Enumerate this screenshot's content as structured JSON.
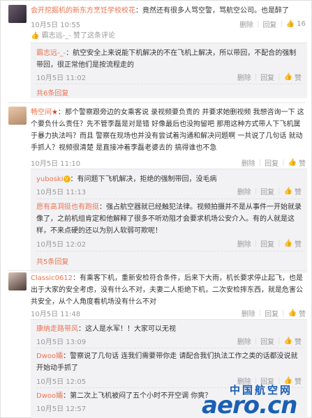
{
  "comments": [
    {
      "author": "会开挖掘机的新东方烹饪学校校花",
      "text": "：竟然还有很多人骂空警，骂航空公司。也是醉了",
      "time": "10月5日 10:55",
      "actions": {
        "delete": "删除",
        "reply": "回复",
        "likes": "16"
      },
      "liked_by": "霸志远-_- 赞了这条评论",
      "replies": [
        {
          "author": "霸志远-_-",
          "text": "：航空安全上来说能下机解决的不在飞机上解决，所以带回，不配合的强制带回，很正常他们是按流程走的",
          "time": "10月5日 11:02",
          "actions": {
            "delete": "删除",
            "reply": "回复",
            "likes": "赞"
          }
        }
      ],
      "more_replies": "共6条回复"
    },
    {
      "author": "畅空间",
      "text": "：那个警察跟旁边的女乘客说 录视频要负责的 并要求她删视频 我想咨询一下 这个要负什么责任？先不管李磊是对是错 好像最后也没拘留吧 那用这种方式带人下飞机属于暴力执法吗？而且 警察在现场也并没有尝试着沟通和解决问题啊 一共说了几句话 就动手抓人？视频很清楚 是直接冲着李磊老婆去的 搞得谁也不急",
      "time": "10月5日 11:10",
      "actions": {
        "delete": "删除",
        "reply": "回复",
        "likes": "赞"
      },
      "replies": [
        {
          "author": "yuboski",
          "text": "：有问题下飞机解决，拒绝的强制带回，没毛病",
          "time": "10月5日 11:13",
          "actions": {
            "delete": "删除",
            "reply": "回复",
            "likes": "赞"
          }
        },
        {
          "author": "愿有高洞挺也有跑挺",
          "text": "：强占航空器就已经触犯法律。视频拍摄并不是从事件一开始就录像了，之前机组肯定和他解释了很多不听劝阻才会要求机场公安介入。有的人就是这样，不来点硬的还以为别人软弱可欺呢！",
          "time": "10月5日 12:02",
          "actions": {
            "delete": "删除",
            "reply": "回复",
            "likes": "赞"
          }
        }
      ],
      "more_replies": "共5条回复"
    },
    {
      "author": "Classic0612",
      "text": "：有乘客下机，重新安检符合条件，后来下大雨，机长要求停止起飞，也是出于大家的安全考虑，没有什么不对，夫妻二人拒绝下机，二次安检摔东西，就是危害公共安全，从个人角度看机场没有什么不对",
      "time": "10月5日 11:48",
      "actions": {
        "delete": "删除",
        "reply": "回复",
        "likes": "赞"
      },
      "replies": [
        {
          "author": "康纳走路带风",
          "text": "：这人是水军！！大家可以无视",
          "time": "10月5日 13:09",
          "actions": {
            "delete": "删除",
            "reply": "回复",
            "likes": "赞"
          }
        },
        {
          "author": "Dwoo孀",
          "text": "：警察说了几句话 连我们需要带你走 请配合我们执法工作之类的话都没说就开始动手抓了",
          "time": "10月5日 12:05",
          "actions": {
            "delete": "删除",
            "reply": "回复",
            "likes": "赞"
          }
        },
        {
          "author": "Dwoo孀",
          "text": "：第二次上飞机被闷了五个小时不开空调 你爽？",
          "time": "10月5日 12:57",
          "actions": {
            "delete": "删除",
            "reply": "回复",
            "likes": "赞"
          }
        }
      ]
    }
  ],
  "watermark": {
    "cn": "中国航空网",
    "en": "aero.cn"
  },
  "colors": {
    "link": "#eb7350",
    "brand": "#1a5fb4",
    "reply_bg": "#f2f2f5"
  }
}
